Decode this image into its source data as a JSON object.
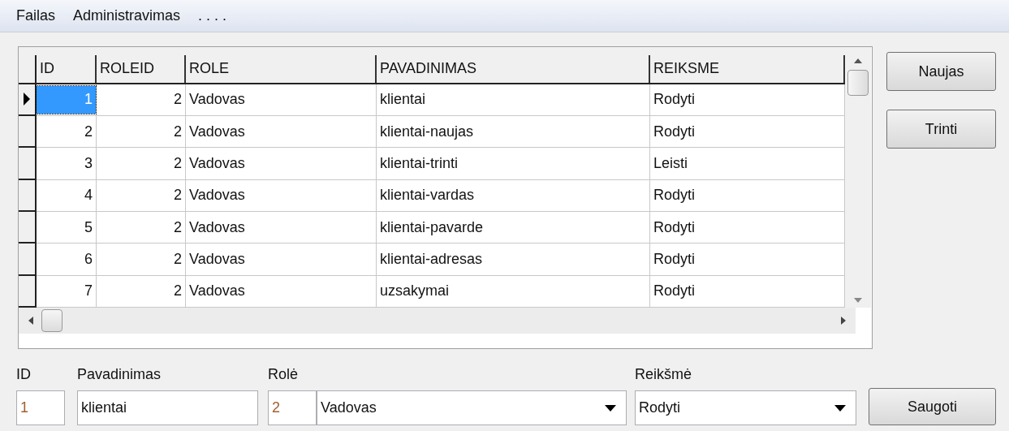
{
  "menu": [
    "Failas",
    "Administravimas",
    ". . . ."
  ],
  "table": {
    "columns": [
      "ID",
      "ROLEID",
      "ROLE",
      "PAVADINIMAS",
      "REIKSME"
    ],
    "rows": [
      {
        "cells": [
          "1",
          "2",
          "Vadovas",
          "klientai",
          "Rodyti"
        ],
        "selected": true
      },
      {
        "cells": [
          "2",
          "2",
          "Vadovas",
          "klientai-naujas",
          "Rodyti"
        ],
        "selected": false
      },
      {
        "cells": [
          "3",
          "2",
          "Vadovas",
          "klientai-trinti",
          "Leisti"
        ],
        "selected": false
      },
      {
        "cells": [
          "4",
          "2",
          "Vadovas",
          "klientai-vardas",
          "Rodyti"
        ],
        "selected": false
      },
      {
        "cells": [
          "5",
          "2",
          "Vadovas",
          "klientai-pavarde",
          "Rodyti"
        ],
        "selected": false
      },
      {
        "cells": [
          "6",
          "2",
          "Vadovas",
          "klientai-adresas",
          "Rodyti"
        ],
        "selected": false
      },
      {
        "cells": [
          "7",
          "2",
          "Vadovas",
          "uzsakymai",
          "Rodyti"
        ],
        "selected": false
      }
    ]
  },
  "side_buttons": [
    "Naujas",
    "Trinti"
  ],
  "form": {
    "id": {
      "label": "ID",
      "value": "1"
    },
    "pavadinimas": {
      "label": "Pavadinimas",
      "value": "klientai"
    },
    "role": {
      "label": "Rolė",
      "id_value": "2",
      "value": "Vadovas"
    },
    "reiksme": {
      "label": "Reikšmė",
      "value": "Rodyti"
    },
    "save_button": "Saugoti"
  }
}
